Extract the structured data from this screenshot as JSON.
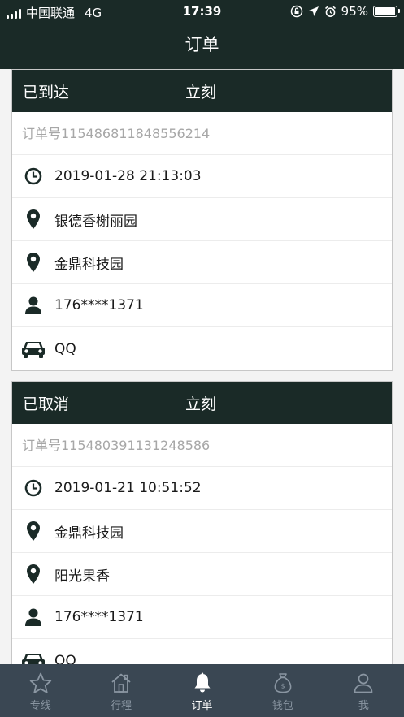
{
  "status_bar": {
    "carrier": "中国联通",
    "network": "4G",
    "time": "17:39",
    "battery": "95%",
    "battery_level": 0.95
  },
  "nav": {
    "title": "订单"
  },
  "orders": [
    {
      "status": "已到达",
      "timing": "立刻",
      "order_no": "订单号115486811848556214",
      "time": "2019-01-28 21:13:03",
      "from": "银德香榭丽园",
      "to": "金鼎科技园",
      "phone": "176****1371",
      "vehicle": "QQ"
    },
    {
      "status": "已取消",
      "timing": "立刻",
      "order_no": "订单号115480391131248586",
      "time": "2019-01-21 10:51:52",
      "from": "金鼎科技园",
      "to": "阳光果香",
      "phone": "176****1371",
      "vehicle": "QQ"
    }
  ],
  "tabbar": {
    "tabs": [
      {
        "label": "专线",
        "icon": "star-icon"
      },
      {
        "label": "行程",
        "icon": "house-icon"
      },
      {
        "label": "订单",
        "icon": "bell-icon"
      },
      {
        "label": "钱包",
        "icon": "money-bag-icon"
      },
      {
        "label": "我",
        "icon": "person-icon"
      }
    ],
    "active_index": 2
  },
  "colors": {
    "header_bg": "#1a2a27",
    "tabbar_bg": "#3a4753",
    "tab_inactive": "#8a96a2",
    "tab_active": "#ffffff",
    "muted_text": "#a7a7a7"
  }
}
